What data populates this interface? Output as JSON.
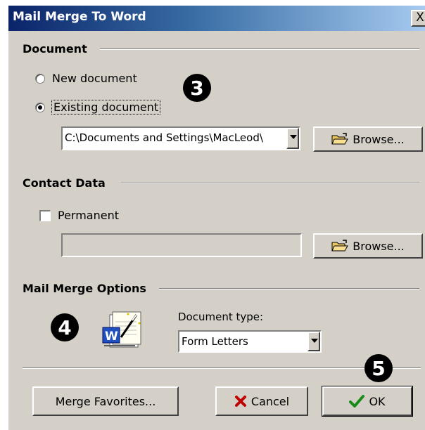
{
  "window": {
    "title": "Mail Merge To Word",
    "close_label": "X"
  },
  "document_group": {
    "header": "Document",
    "option_new": "New document",
    "option_existing": "Existing document",
    "selected": "Existing document",
    "path_value": "C:\\Documents and Settings\\MacLeod\\",
    "browse_label": "Browse..."
  },
  "contact_group": {
    "header": "Contact Data",
    "permanent_label": "Permanent",
    "permanent_checked": false,
    "path_value": "",
    "browse_label": "Browse..."
  },
  "options_group": {
    "header": "Mail Merge Options",
    "doc_type_label": "Document type:",
    "doc_type_value": "Form Letters",
    "icon": "word-mail-merge-wizard-icon"
  },
  "footer": {
    "favorites_label": "Merge Favorites...",
    "cancel_label": "Cancel",
    "ok_label": "OK"
  },
  "callouts": {
    "three": "3",
    "four": "4",
    "five": "5"
  }
}
